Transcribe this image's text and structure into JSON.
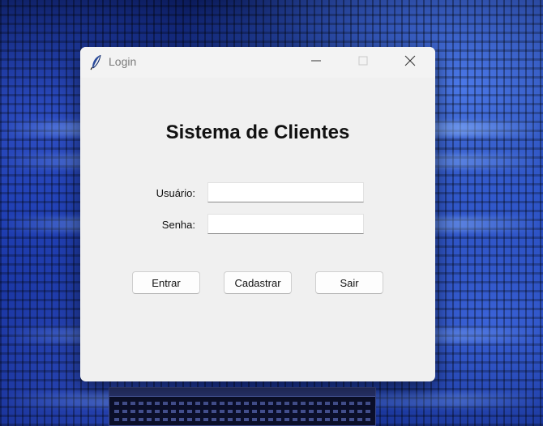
{
  "window": {
    "title": "Login"
  },
  "form": {
    "heading": "Sistema de Clientes",
    "username_label": "Usuário:",
    "username_value": "",
    "password_label": "Senha:",
    "password_value": ""
  },
  "buttons": {
    "entrar": "Entrar",
    "cadastrar": "Cadastrar",
    "sair": "Sair"
  },
  "icons": {
    "app": "feather-icon",
    "minimize": "minimize-icon",
    "maximize": "maximize-icon",
    "close": "close-icon"
  }
}
